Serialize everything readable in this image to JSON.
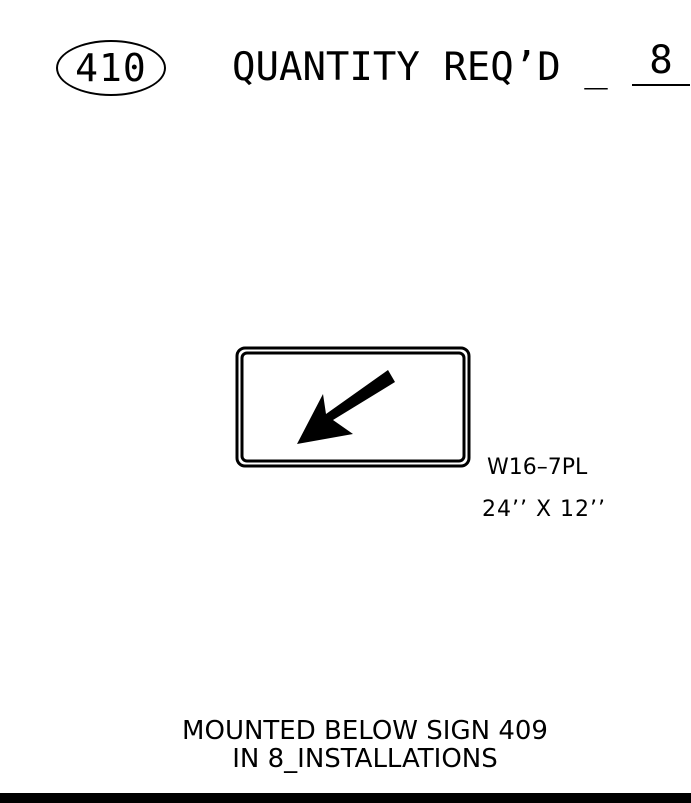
{
  "header": {
    "sign_number": "410",
    "quantity_label": "QUANTITY REQ’D _",
    "quantity_value": "8"
  },
  "sign": {
    "arrow_icon": "down-left-arrow-icon",
    "code": "W16–7PL",
    "size": "24’’ X 12’’",
    "colors": {
      "background": "#ffffff",
      "border": "#000000",
      "legend": "#000000"
    }
  },
  "note": {
    "line1": "MOUNTED BELOW SIGN 409",
    "line2": "IN 8_INSTALLATIONS"
  }
}
